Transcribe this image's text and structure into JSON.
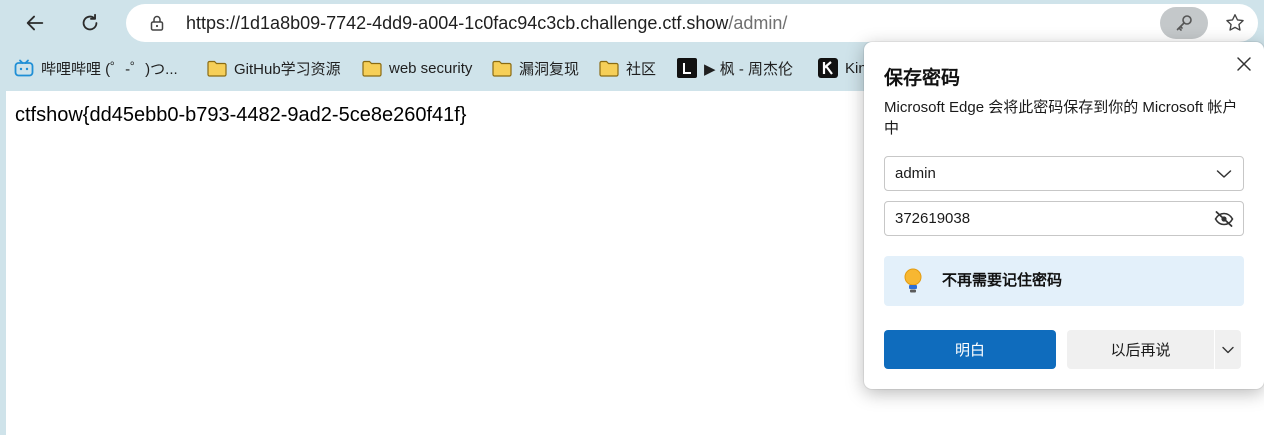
{
  "browser": {
    "url_base": "https://1d1a8b09-7742-4dd9-a004-1c0fac94c3cb.challenge.ctf.show",
    "url_path": "/admin/"
  },
  "bookmarks": [
    {
      "label": "哔哩哔哩 (゜-゜)つ...",
      "icon": "bilibili-icon"
    },
    {
      "label": "GitHub学习资源",
      "icon": "folder-icon"
    },
    {
      "label": "web security",
      "icon": "folder-icon"
    },
    {
      "label": "漏洞复现",
      "icon": "folder-icon"
    },
    {
      "label": "社区",
      "icon": "folder-icon"
    },
    {
      "label": "▶ 枫 - 周杰伦",
      "icon": "l-logo-icon"
    },
    {
      "label": "Kin",
      "icon": "k-logo-icon"
    }
  ],
  "page": {
    "flag_text": "ctfshow{dd45ebb0-b793-4482-9ad2-5ce8e260f41f}"
  },
  "popup": {
    "title": "保存密码",
    "description": "Microsoft Edge 会将此密码保存到你的 Microsoft 帐户中",
    "username": "admin",
    "password": "372619038",
    "tip": "不再需要记住密码",
    "primary_button": "明白",
    "secondary_button": "以后再说"
  },
  "colors": {
    "chrome_bg": "#cfe3ea",
    "primary": "#0f6cbd",
    "tip_bg": "#e3f0fa"
  }
}
